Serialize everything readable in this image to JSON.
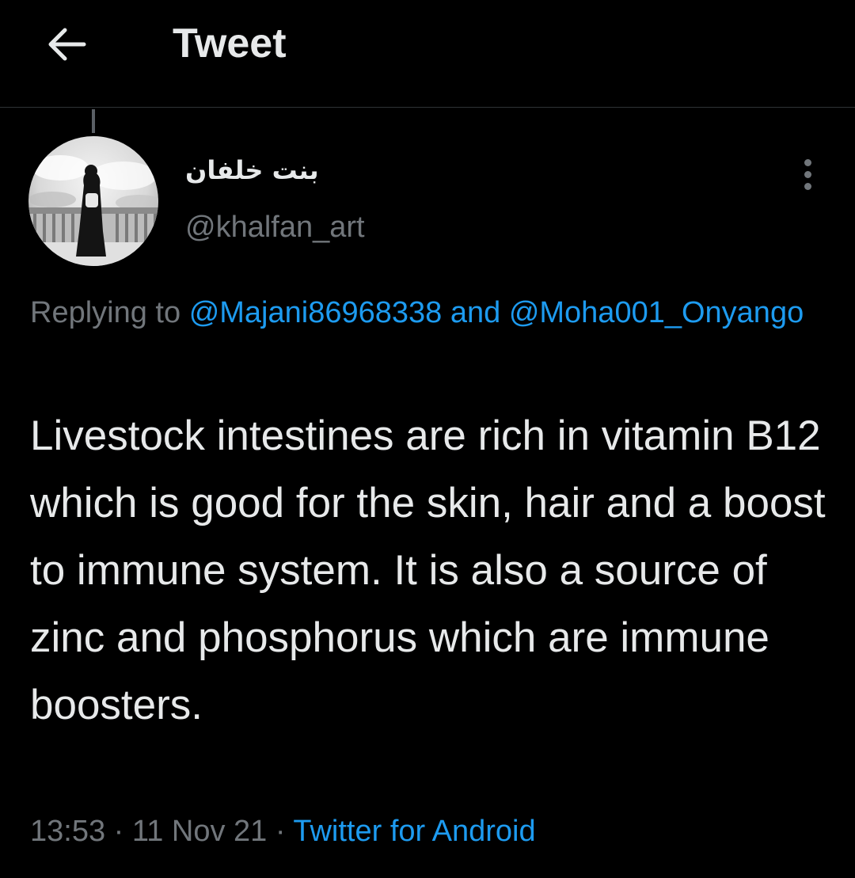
{
  "header": {
    "title": "Tweet",
    "back_icon": "arrow-left-icon"
  },
  "tweet": {
    "author": {
      "display_name": "بنت خلفان",
      "handle": "@khalfan_art",
      "avatar": "woman-on-balcony-avatar"
    },
    "more_icon": "more-vertical-icon",
    "replying": {
      "prefix": "Replying to",
      "mention_1": "@Majani86968338",
      "conjunction": "and",
      "mention_2": "@Moha001_Onyango"
    },
    "text": "Livestock intestines are rich in vitamin B12 which is good for the skin, hair and a boost to immune system. It is also a source of zinc and phosphorus which are immune boosters.",
    "time": "13:53",
    "date": "11 Nov 21",
    "separator": "·",
    "source": "Twitter for Android"
  },
  "colors": {
    "background": "#000000",
    "text_primary": "#e7e9ea",
    "text_secondary": "#71767b",
    "accent": "#1d9bf0",
    "divider": "#2f3336"
  }
}
